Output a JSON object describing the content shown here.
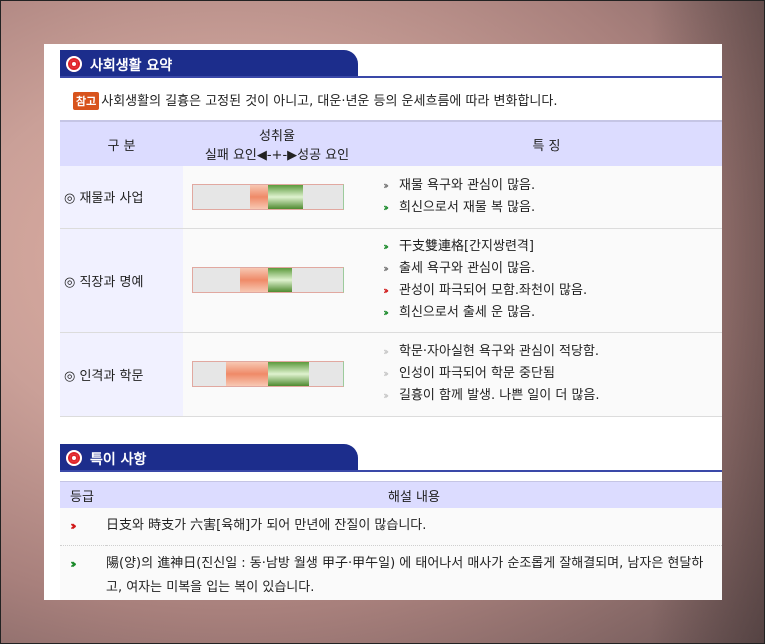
{
  "section1": {
    "title": "사회생활 요약"
  },
  "note": {
    "badge": "참고",
    "text": "사회생활의 길흉은 고정된 것이 아니고, 대운·년운 등의 운세흐름에 따라 변화합니다."
  },
  "summary_table": {
    "headers": {
      "category": "구 분",
      "rate_title": "성취율",
      "rate_scale": "실패 요인◀-+-▶성공 요인",
      "features": "특 징"
    },
    "rows": [
      {
        "category": "◎ 재물과 사업",
        "bar": {
          "neg_start": 0.38,
          "neg_end": 0.5,
          "pos_start": 0.5,
          "pos_end": 0.73
        },
        "features": [
          {
            "arrow": "gray",
            "text": "재물 욕구와 관심이 많음."
          },
          {
            "arrow": "green",
            "text": "희신으로서 재물 복 많음."
          }
        ]
      },
      {
        "category": "◎ 직장과 명예",
        "bar": {
          "neg_start": 0.31,
          "neg_end": 0.5,
          "pos_start": 0.5,
          "pos_end": 0.66
        },
        "features": [
          {
            "arrow": "green",
            "text": "干支雙連格[간지쌍련격]"
          },
          {
            "arrow": "gray",
            "text": "출세 욕구와 관심이 많음."
          },
          {
            "arrow": "red",
            "text": "관성이 파극되어 모함.좌천이 많음."
          },
          {
            "arrow": "green",
            "text": "희신으로서 출세 운 많음."
          }
        ]
      },
      {
        "category": "◎ 인격과 학문",
        "bar": {
          "neg_start": 0.22,
          "neg_end": 0.5,
          "pos_start": 0.5,
          "pos_end": 0.77
        },
        "features": [
          {
            "arrow": "light",
            "text": "학문·자아실현 욕구와 관심이 적당함."
          },
          {
            "arrow": "light",
            "text": "인성이 파극되어 학문 중단됨"
          },
          {
            "arrow": "light",
            "text": "길흉이 함께 발생. 나쁜 일이 더 많음."
          }
        ]
      }
    ]
  },
  "section2": {
    "title": "특이 사항"
  },
  "special_table": {
    "headers": {
      "grade": "등급",
      "content": "해설 내용"
    },
    "rows": [
      {
        "arrow": "red",
        "text": "日支와 時支가 六害[육해]가 되어 만년에 잔질이 많습니다."
      },
      {
        "arrow": "green",
        "text": "陽(양)의 進神日(진신일 : 동·남방 월생 甲子·甲午일) 에 태어나서 매사가 순조롭게 잘해결되며, 남자은 현달하고, 여자는 미복을 입는 복이 있습니다."
      }
    ]
  },
  "colors": {
    "header_blue": "#1c2d8c",
    "table_header": "#dcdcff",
    "accent_red": "#d01818",
    "accent_green": "#1a8a2a"
  }
}
